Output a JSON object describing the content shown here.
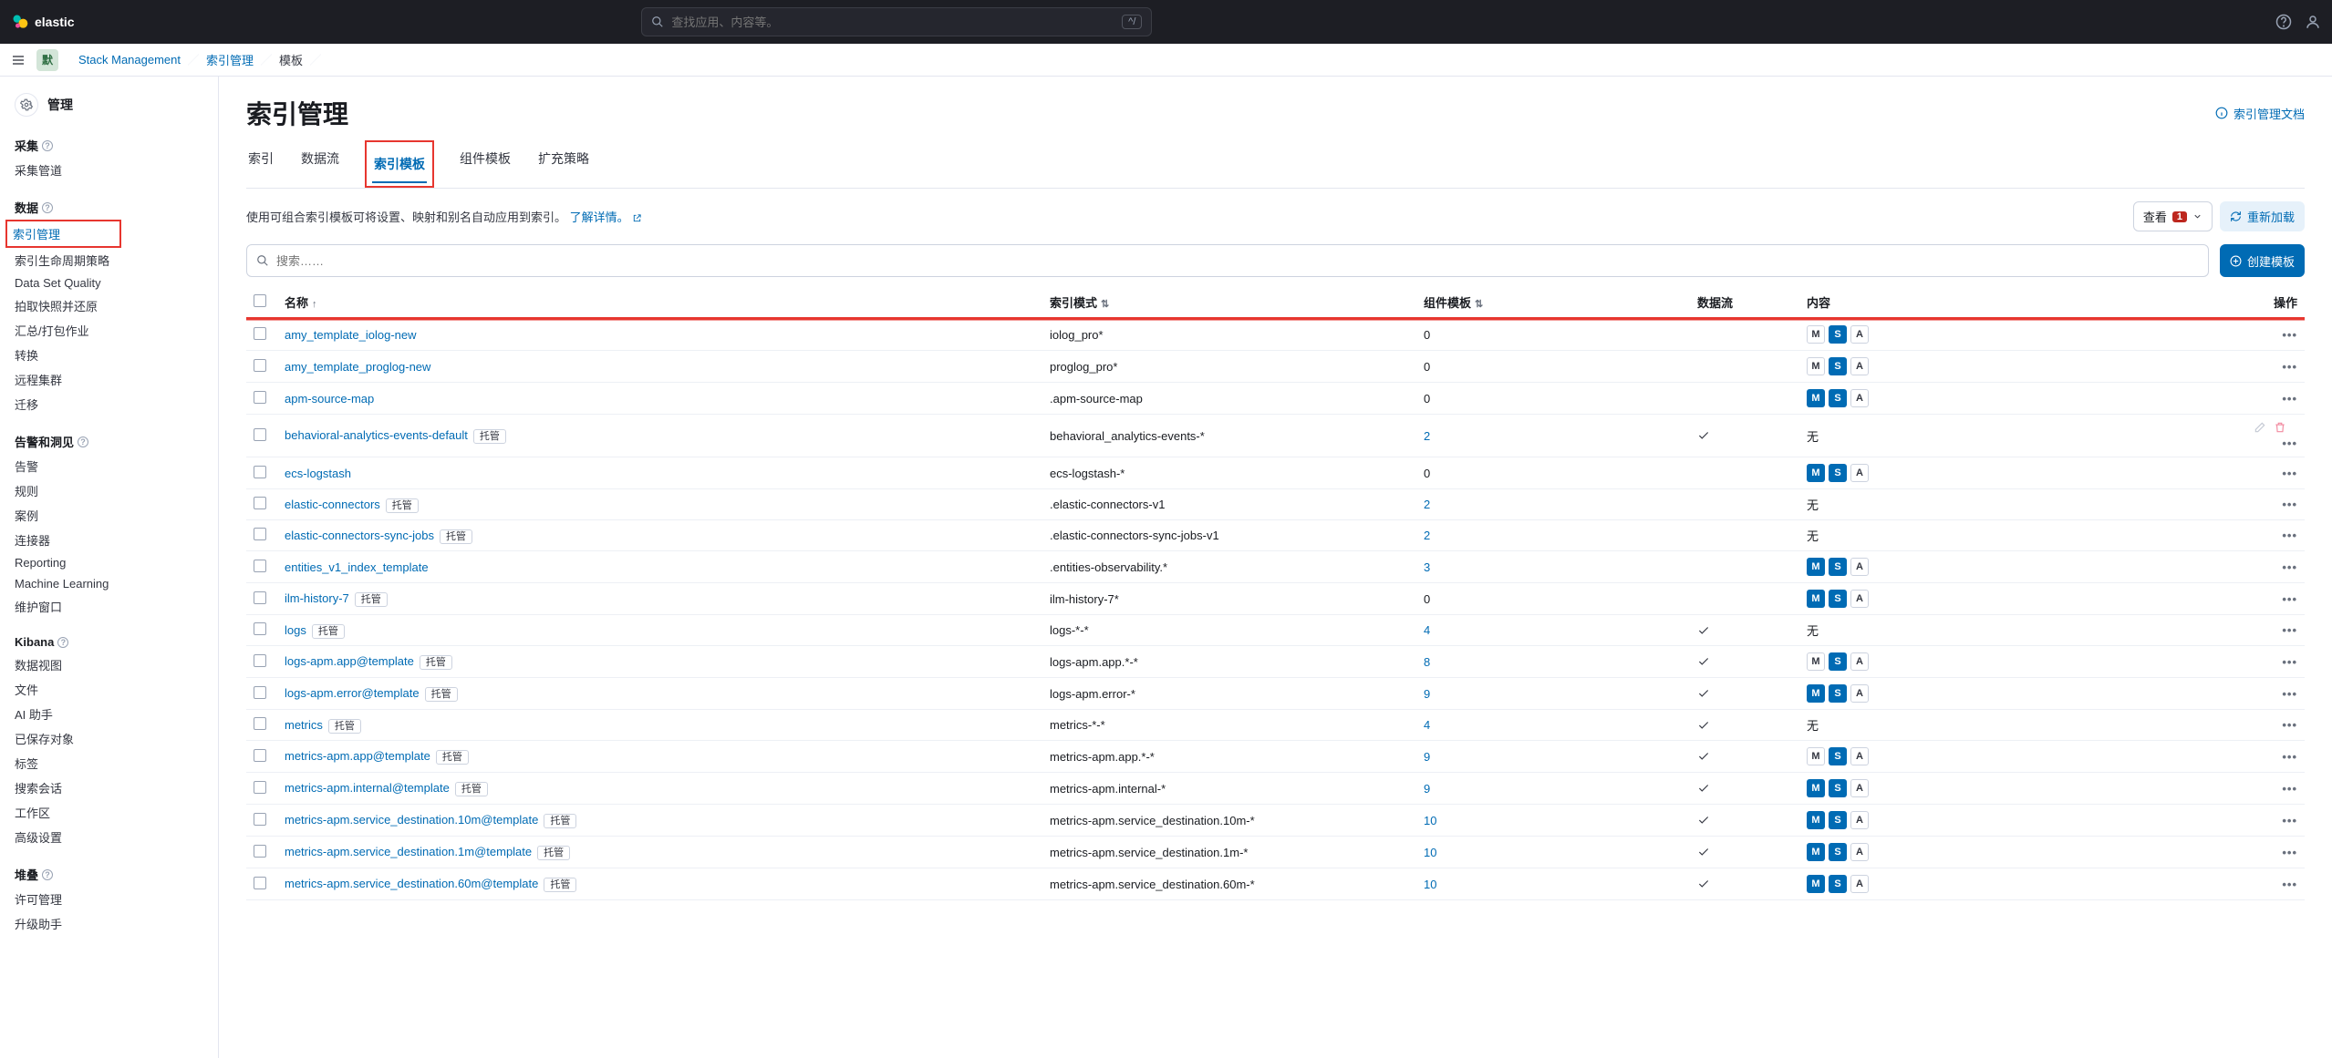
{
  "brand": "elastic",
  "search_placeholder": "查找应用、内容等。",
  "search_shortcut": "^/",
  "breadcrumb": [
    "默",
    "Stack Management",
    "索引管理",
    "模板"
  ],
  "sidebar": {
    "heading": "管理",
    "sections": [
      {
        "title": "采集",
        "info": true,
        "items": [
          "采集管道"
        ]
      },
      {
        "title": "数据",
        "info": true,
        "items": [
          "索引管理",
          "索引生命周期策略",
          "Data Set Quality",
          "拍取快照并还原",
          "汇总/打包作业",
          "转换",
          "远程集群",
          "迁移"
        ],
        "selectedIndex": 0
      },
      {
        "title": "告警和洞见",
        "info": true,
        "items": [
          "告警",
          "规则",
          "案例",
          "连接器",
          "Reporting",
          "Machine Learning",
          "维护窗口"
        ]
      },
      {
        "title": "Kibana",
        "info": true,
        "items": [
          "数据视图",
          "文件",
          "AI 助手",
          "已保存对象",
          "标签",
          "搜索会话",
          "工作区",
          "高级设置"
        ]
      },
      {
        "title": "堆叠",
        "info": true,
        "items": [
          "许可管理",
          "升级助手"
        ]
      }
    ]
  },
  "page": {
    "title": "索引管理",
    "doc_link": "索引管理文档",
    "tabs": [
      "索引",
      "数据流",
      "索引模板",
      "组件模板",
      "扩充策略"
    ],
    "active_tab": 2,
    "description": "使用可组合索引模板可将设置、映射和别名自动应用到索引。",
    "learn_more": "了解详情。",
    "view_label": "查看",
    "view_badge": "1",
    "reload": "重新加载",
    "create": "创建模板",
    "filter_placeholder": "搜索……"
  },
  "columns": {
    "name": "名称",
    "pattern": "索引模式",
    "component": "组件模板",
    "datastream": "数据流",
    "content": "内容",
    "actions": "操作"
  },
  "none_text": "无",
  "managed_tag": "托管",
  "rows": [
    {
      "name": "amy_template_iolog-new",
      "pat": "iolog_pro*",
      "comp": "0",
      "ds": "",
      "content": {
        "m": "o",
        "s": "f",
        "a": "o"
      },
      "hl": true
    },
    {
      "name": "amy_template_proglog-new",
      "pat": "proglog_pro*",
      "comp": "0",
      "ds": "",
      "content": {
        "m": "o",
        "s": "f",
        "a": "o"
      },
      "hl": true
    },
    {
      "name": "apm-source-map",
      "pat": ".apm-source-map",
      "comp": "0",
      "ds": "",
      "content": {
        "m": "f",
        "s": "f",
        "a": "o"
      }
    },
    {
      "name": "behavioral-analytics-events-default",
      "managed": true,
      "pat": "behavioral_analytics-events-*",
      "comp": "2",
      "ds": "y",
      "content": "none",
      "edit": true
    },
    {
      "name": "ecs-logstash",
      "pat": "ecs-logstash-*",
      "comp": "0",
      "ds": "",
      "content": {
        "m": "f",
        "s": "f",
        "a": "o"
      }
    },
    {
      "name": "elastic-connectors",
      "managed": true,
      "pat": ".elastic-connectors-v1",
      "comp": "2",
      "ds": "",
      "content": "none"
    },
    {
      "name": "elastic-connectors-sync-jobs",
      "managed": true,
      "pat": ".elastic-connectors-sync-jobs-v1",
      "comp": "2",
      "ds": "",
      "content": "none"
    },
    {
      "name": "entities_v1_index_template",
      "pat": ".entities-observability.*",
      "comp": "3",
      "ds": "",
      "content": {
        "m": "f",
        "s": "f",
        "a": "o"
      }
    },
    {
      "name": "ilm-history-7",
      "managed": true,
      "pat": "ilm-history-7*",
      "comp": "0",
      "ds": "",
      "content": {
        "m": "f",
        "s": "f",
        "a": "o"
      }
    },
    {
      "name": "logs",
      "managed": true,
      "pat": "logs-*-*",
      "comp": "4",
      "ds": "y",
      "content": "none"
    },
    {
      "name": "logs-apm.app@template",
      "managed": true,
      "pat": "logs-apm.app.*-*",
      "comp": "8",
      "ds": "y",
      "content": {
        "m": "o",
        "s": "f",
        "a": "o"
      }
    },
    {
      "name": "logs-apm.error@template",
      "managed": true,
      "pat": "logs-apm.error-*",
      "comp": "9",
      "ds": "y",
      "content": {
        "m": "f",
        "s": "f",
        "a": "o"
      }
    },
    {
      "name": "metrics",
      "managed": true,
      "pat": "metrics-*-*",
      "comp": "4",
      "ds": "y",
      "content": "none"
    },
    {
      "name": "metrics-apm.app@template",
      "managed": true,
      "pat": "metrics-apm.app.*-*",
      "comp": "9",
      "ds": "y",
      "content": {
        "m": "o",
        "s": "f",
        "a": "o"
      }
    },
    {
      "name": "metrics-apm.internal@template",
      "managed": true,
      "pat": "metrics-apm.internal-*",
      "comp": "9",
      "ds": "y",
      "content": {
        "m": "f",
        "s": "f",
        "a": "o"
      }
    },
    {
      "name": "metrics-apm.service_destination.10m@template",
      "managed": true,
      "pat": "metrics-apm.service_destination.10m-*",
      "comp": "10",
      "ds": "y",
      "content": {
        "m": "f",
        "s": "f",
        "a": "o"
      }
    },
    {
      "name": "metrics-apm.service_destination.1m@template",
      "managed": true,
      "pat": "metrics-apm.service_destination.1m-*",
      "comp": "10",
      "ds": "y",
      "content": {
        "m": "f",
        "s": "f",
        "a": "o"
      }
    },
    {
      "name": "metrics-apm.service_destination.60m@template",
      "managed": true,
      "pat": "metrics-apm.service_destination.60m-*",
      "comp": "10",
      "ds": "y",
      "content": {
        "m": "f",
        "s": "f",
        "a": "o"
      }
    }
  ]
}
